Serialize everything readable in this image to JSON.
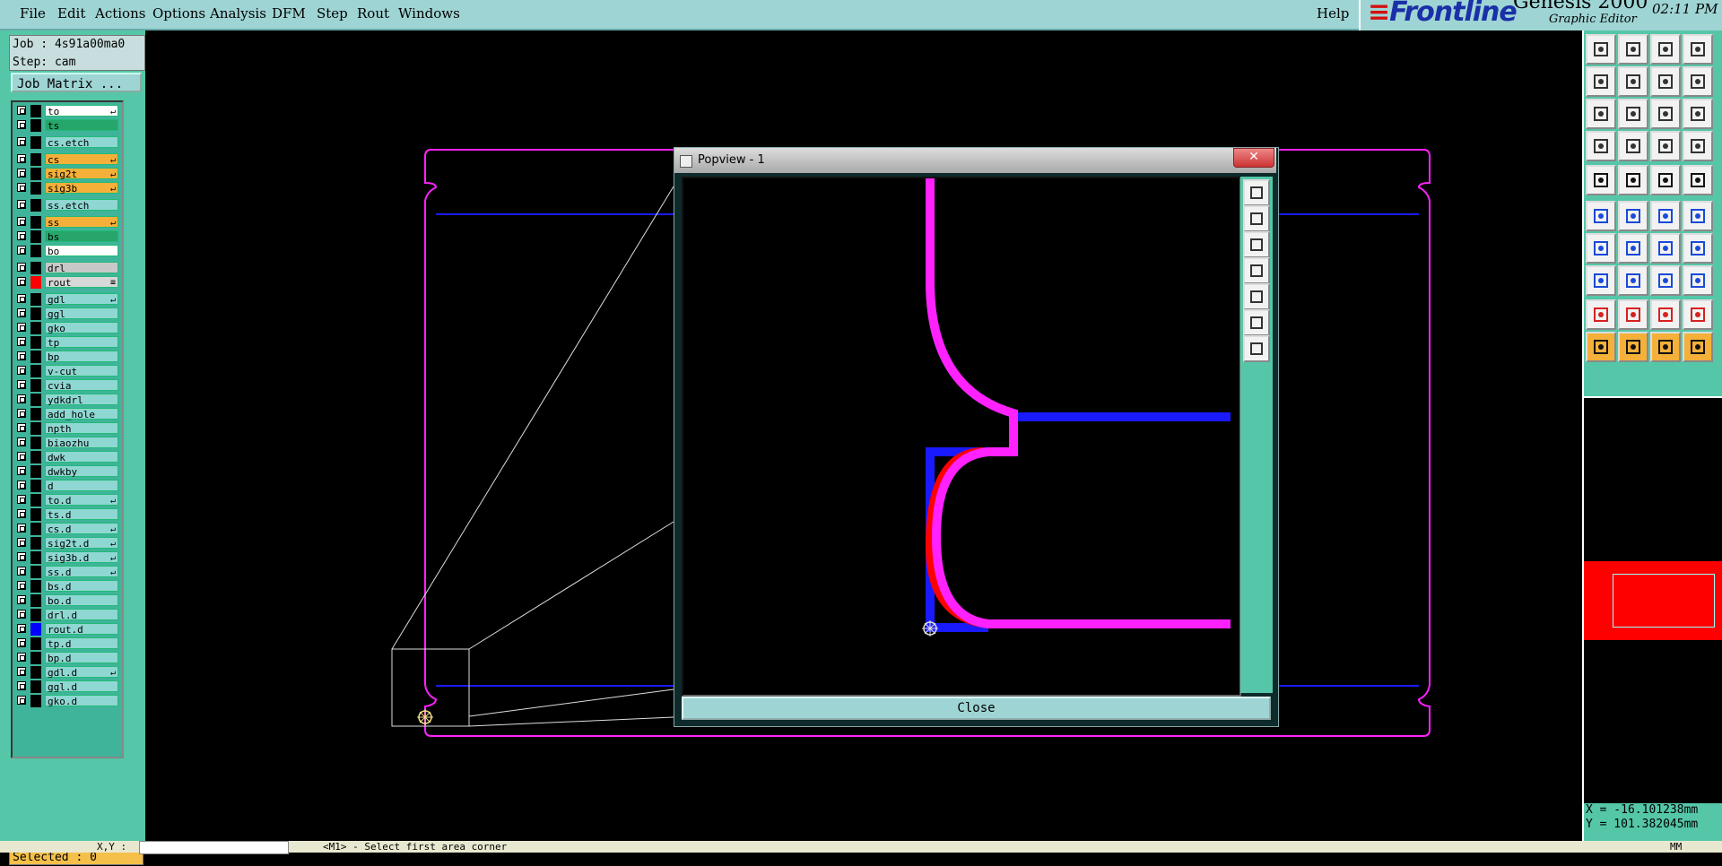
{
  "menu": [
    "File",
    "Edit",
    "Actions",
    "Options",
    "Analysis",
    "DFM",
    "Step",
    "Rout",
    "Windows"
  ],
  "help": "Help",
  "brand": {
    "logo": "Frontline",
    "product": "Genesis 2000",
    "subtitle": "Graphic Editor",
    "time": "02:11 PM"
  },
  "job": {
    "job_line": "Job : 4s91a00ma0",
    "step_line": "Step: cam",
    "matrix_button": "Job Matrix ..."
  },
  "layers": [
    {
      "name": "to",
      "color": "#ffffff",
      "swatch": "#000000",
      "mark": "↵"
    },
    {
      "name": "ts",
      "color": "#26a66a",
      "swatch": "#000000",
      "mark": ""
    },
    {
      "name": "cs.etch",
      "color": "#8fd7d2",
      "swatch": "#000000",
      "mark": ""
    },
    {
      "name": "cs",
      "color": "#f5b03a",
      "swatch": "#000000",
      "mark": "↵"
    },
    {
      "name": "sig2t",
      "color": "#f5b03a",
      "swatch": "#000000",
      "mark": "↵"
    },
    {
      "name": "sig3b",
      "color": "#f5b03a",
      "swatch": "#000000",
      "mark": "↵"
    },
    {
      "name": "ss.etch",
      "color": "#8fd7d2",
      "swatch": "#000000",
      "mark": ""
    },
    {
      "name": "ss",
      "color": "#f5b03a",
      "swatch": "#000000",
      "mark": "↵"
    },
    {
      "name": "bs",
      "color": "#26a66a",
      "swatch": "#000000",
      "mark": ""
    },
    {
      "name": "bo",
      "color": "#ffffff",
      "swatch": "#000000",
      "mark": ""
    },
    {
      "name": "drl",
      "color": "#c8c8c8",
      "swatch": "#000000",
      "mark": ""
    },
    {
      "name": "rout",
      "color": "#d8d8d8",
      "swatch": "#ff0000",
      "mark": "≡"
    },
    {
      "name": "gdl",
      "color": "#8fd7d2",
      "swatch": "#000000",
      "mark": "↵"
    },
    {
      "name": "ggl",
      "color": "#8fd7d2",
      "swatch": "#000000",
      "mark": ""
    },
    {
      "name": "gko",
      "color": "#8fd7d2",
      "swatch": "#000000",
      "mark": ""
    },
    {
      "name": "tp",
      "color": "#8fd7d2",
      "swatch": "#000000",
      "mark": ""
    },
    {
      "name": "bp",
      "color": "#8fd7d2",
      "swatch": "#000000",
      "mark": ""
    },
    {
      "name": "v-cut",
      "color": "#8fd7d2",
      "swatch": "#000000",
      "mark": ""
    },
    {
      "name": "cvia",
      "color": "#8fd7d2",
      "swatch": "#000000",
      "mark": ""
    },
    {
      "name": "ydkdrl",
      "color": "#8fd7d2",
      "swatch": "#000000",
      "mark": ""
    },
    {
      "name": "add_hole",
      "color": "#8fd7d2",
      "swatch": "#000000",
      "mark": ""
    },
    {
      "name": "npth",
      "color": "#8fd7d2",
      "swatch": "#000000",
      "mark": ""
    },
    {
      "name": "biaozhu",
      "color": "#8fd7d2",
      "swatch": "#000000",
      "mark": ""
    },
    {
      "name": "dwk",
      "color": "#8fd7d2",
      "swatch": "#000000",
      "mark": ""
    },
    {
      "name": "dwkby",
      "color": "#8fd7d2",
      "swatch": "#000000",
      "mark": ""
    },
    {
      "name": "d",
      "color": "#8fd7d2",
      "swatch": "#000000",
      "mark": ""
    },
    {
      "name": "to.d",
      "color": "#8fd7d2",
      "swatch": "#000000",
      "mark": "↵"
    },
    {
      "name": "ts.d",
      "color": "#8fd7d2",
      "swatch": "#000000",
      "mark": ""
    },
    {
      "name": "cs.d",
      "color": "#8fd7d2",
      "swatch": "#000000",
      "mark": "↵"
    },
    {
      "name": "sig2t.d",
      "color": "#8fd7d2",
      "swatch": "#000000",
      "mark": "↵"
    },
    {
      "name": "sig3b.d",
      "color": "#8fd7d2",
      "swatch": "#000000",
      "mark": "↵"
    },
    {
      "name": "ss.d",
      "color": "#8fd7d2",
      "swatch": "#000000",
      "mark": "↵"
    },
    {
      "name": "bs.d",
      "color": "#8fd7d2",
      "swatch": "#000000",
      "mark": ""
    },
    {
      "name": "bo.d",
      "color": "#8fd7d2",
      "swatch": "#000000",
      "mark": ""
    },
    {
      "name": "drl.d",
      "color": "#8fd7d2",
      "swatch": "#000000",
      "mark": ""
    },
    {
      "name": "rout.d",
      "color": "#8fd7d2",
      "swatch": "#0000ff",
      "mark": ""
    },
    {
      "name": "tp.d",
      "color": "#8fd7d2",
      "swatch": "#000000",
      "mark": ""
    },
    {
      "name": "bp.d",
      "color": "#8fd7d2",
      "swatch": "#000000",
      "mark": ""
    },
    {
      "name": "gdl.d",
      "color": "#8fd7d2",
      "swatch": "#000000",
      "mark": "↵"
    },
    {
      "name": "ggl.d",
      "color": "#8fd7d2",
      "swatch": "#000000",
      "mark": ""
    },
    {
      "name": "gko.d",
      "color": "#8fd7d2",
      "swatch": "#000000",
      "mark": ""
    }
  ],
  "selected": "Selected : 0",
  "popup": {
    "title": "Popview - 1",
    "close_x": "✕",
    "close_button": "Close"
  },
  "coords": {
    "x": "X = -16.101238mm",
    "y": "Y = 101.382045mm"
  },
  "status": {
    "xy_label": "X,Y :",
    "message": "<M1> - Select first area corner",
    "units": "MM"
  },
  "colors": {
    "magenta": "#ff22ff",
    "blue": "#1a1aff",
    "red": "#ff0000",
    "teal": "#55c7a8"
  }
}
